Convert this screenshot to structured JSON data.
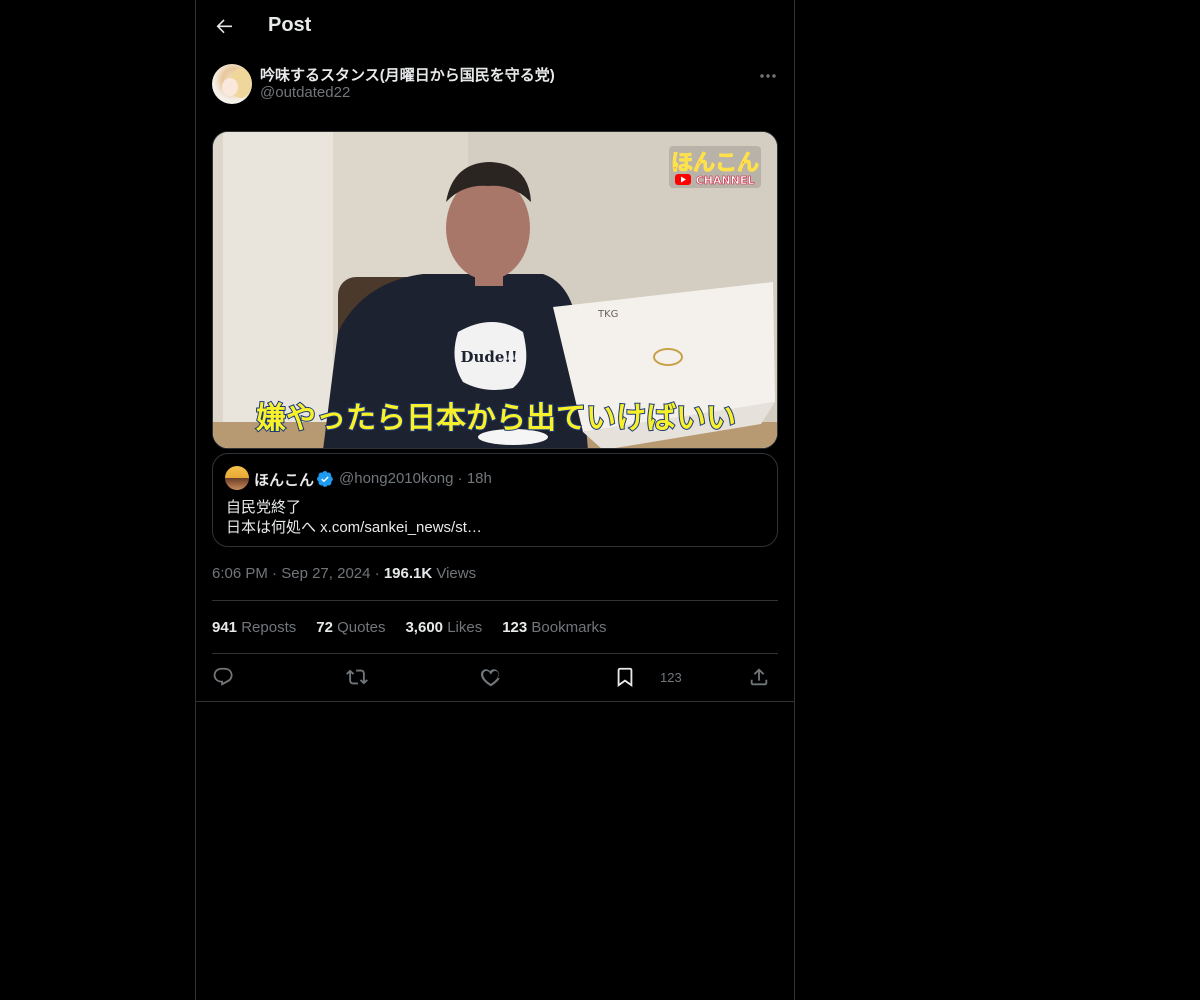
{
  "header": {
    "title": "Post"
  },
  "author": {
    "display_name": "吟味するスタンス(月曜日から国民を守る党)",
    "handle": "@outdated22"
  },
  "media": {
    "logo_top": "ほんこん",
    "logo_bottom": "CHANNEL",
    "shirt_text": "Dude!!",
    "laptop_text": "TKG",
    "caption": "嫌やったら日本から出ていけばいい"
  },
  "quote": {
    "name": "ほんこん",
    "handle_time": "@hong2010kong · 18h",
    "line1": "自民党終了",
    "line2": "日本は何処へ x.com/sankei_news/st…"
  },
  "meta": {
    "time": "6:06 PM",
    "date": "Sep 27, 2024",
    "views_count": "196.1K",
    "views_label": "Views"
  },
  "stats": {
    "reposts_count": "941",
    "reposts_label": "Reposts",
    "quotes_count": "72",
    "quotes_label": "Quotes",
    "likes_count": "3,600",
    "likes_label": "Likes",
    "bookmarks_count": "123",
    "bookmarks_label": "Bookmarks"
  },
  "actions": {
    "bookmark_count": "123"
  },
  "colors": {
    "background": "#000000",
    "border": "#2f3336",
    "text": "#e7e9ea",
    "muted": "#71767b",
    "verified": "#1d9bf0"
  }
}
